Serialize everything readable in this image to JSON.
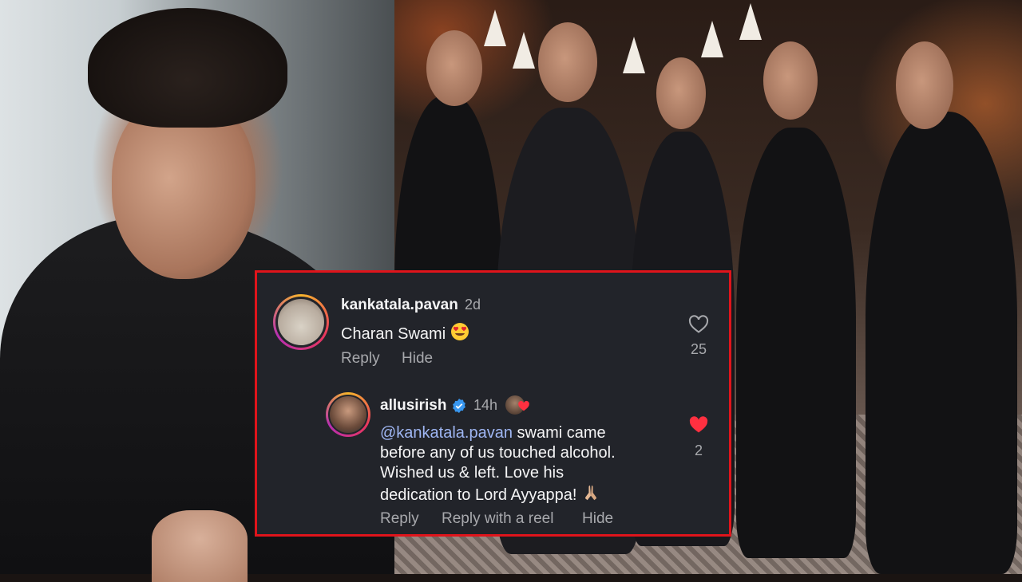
{
  "comments": [
    {
      "username": "kankatala.pavan",
      "time": "2d",
      "text": "Charan Swami",
      "emoji": "heart-eyes",
      "likes": "25",
      "liked": false,
      "actions": [
        "Reply",
        "Hide"
      ]
    },
    {
      "username": "allusirish",
      "verified": true,
      "time": "14h",
      "mention": "@kankatala.pavan",
      "text_lines": [
        " swami came",
        "before any of us touched alcohol.",
        "Wished us & left. Love his",
        "dedication to Lord Ayyappa!"
      ],
      "emoji": "folded-hands",
      "likes": "2",
      "liked": true,
      "actions": [
        "Reply",
        "Reply with a reel",
        "Hide"
      ]
    }
  ],
  "colors": {
    "card_bg": "#22242a",
    "card_border": "#e0141b",
    "mention": "#9fb6f3",
    "liked_heart": "#ff3040",
    "verified": "#3897f0"
  }
}
